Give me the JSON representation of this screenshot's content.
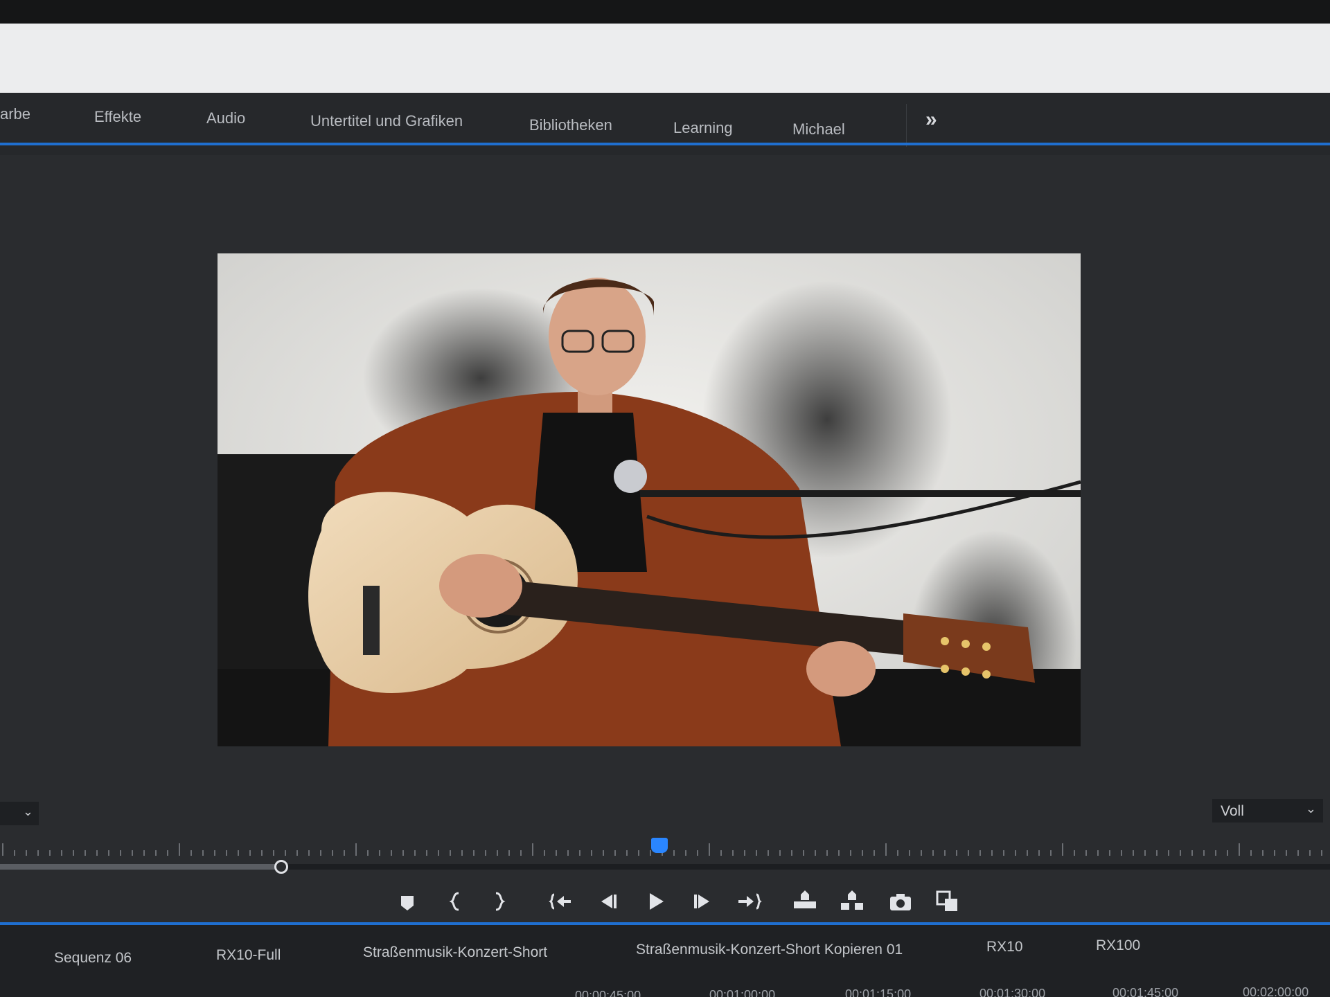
{
  "workspace": {
    "tabs": [
      "arbe",
      "Effekte",
      "Audio",
      "Untertitel und Grafiken",
      "Bibliotheken",
      "Learning",
      "Michael"
    ],
    "more_label": "»"
  },
  "program_monitor": {
    "fit_select": {
      "selected": ""
    },
    "resolution_select": {
      "selected": "Voll"
    }
  },
  "transport_icons": [
    "add-marker-icon",
    "mark-in-icon",
    "mark-out-icon",
    "go-to-in-icon",
    "step-back-icon",
    "play-icon",
    "step-forward-icon",
    "go-to-out-icon",
    "lift-icon",
    "extract-icon",
    "export-frame-icon",
    "compare-view-icon"
  ],
  "timeline": {
    "sequence_tabs": [
      "Sequenz 06",
      "RX10-Full",
      "Straßenmusik-Konzert-Short",
      "Straßenmusik-Konzert-Short Kopieren 01",
      "RX10",
      "RX100"
    ],
    "timecodes": [
      "00:00:45:00",
      "00:01:00:00",
      "00:01:15:00",
      "00:01:30:00",
      "00:01:45:00",
      "00:02:00:00"
    ]
  },
  "colors": {
    "accent_blue": "#1f6fd0",
    "panel_bg": "#2a2c2f",
    "tab_bar_bg": "#26282b",
    "timeline_bg": "#1f2124"
  }
}
